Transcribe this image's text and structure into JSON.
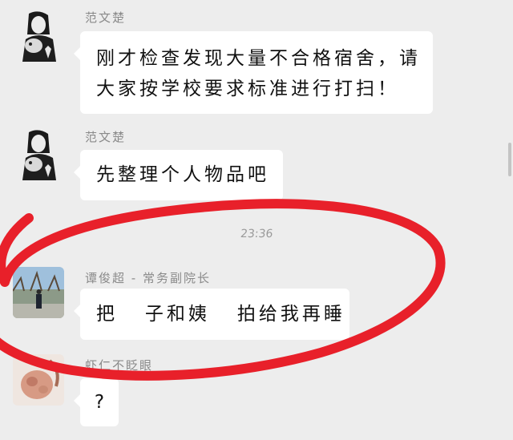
{
  "messages": [
    {
      "sender": "范文楚",
      "text": "刚才检查发现大量不合格宿舍，请\n大家按学校要求标准进行打扫！"
    },
    {
      "sender": "范文楚",
      "text": "先整理个人物品吧"
    },
    {
      "sender": "谭俊超 - 常务副院长",
      "text": "把   子和姨   拍给我再睡"
    },
    {
      "sender": "虾仁不眨眼",
      "text": "?"
    }
  ],
  "timestamp": "23:36",
  "annotation": {
    "color": "#e8202a"
  },
  "colors": {
    "background": "#ededed",
    "bubble": "#ffffff",
    "sender": "#8a8a8a"
  }
}
